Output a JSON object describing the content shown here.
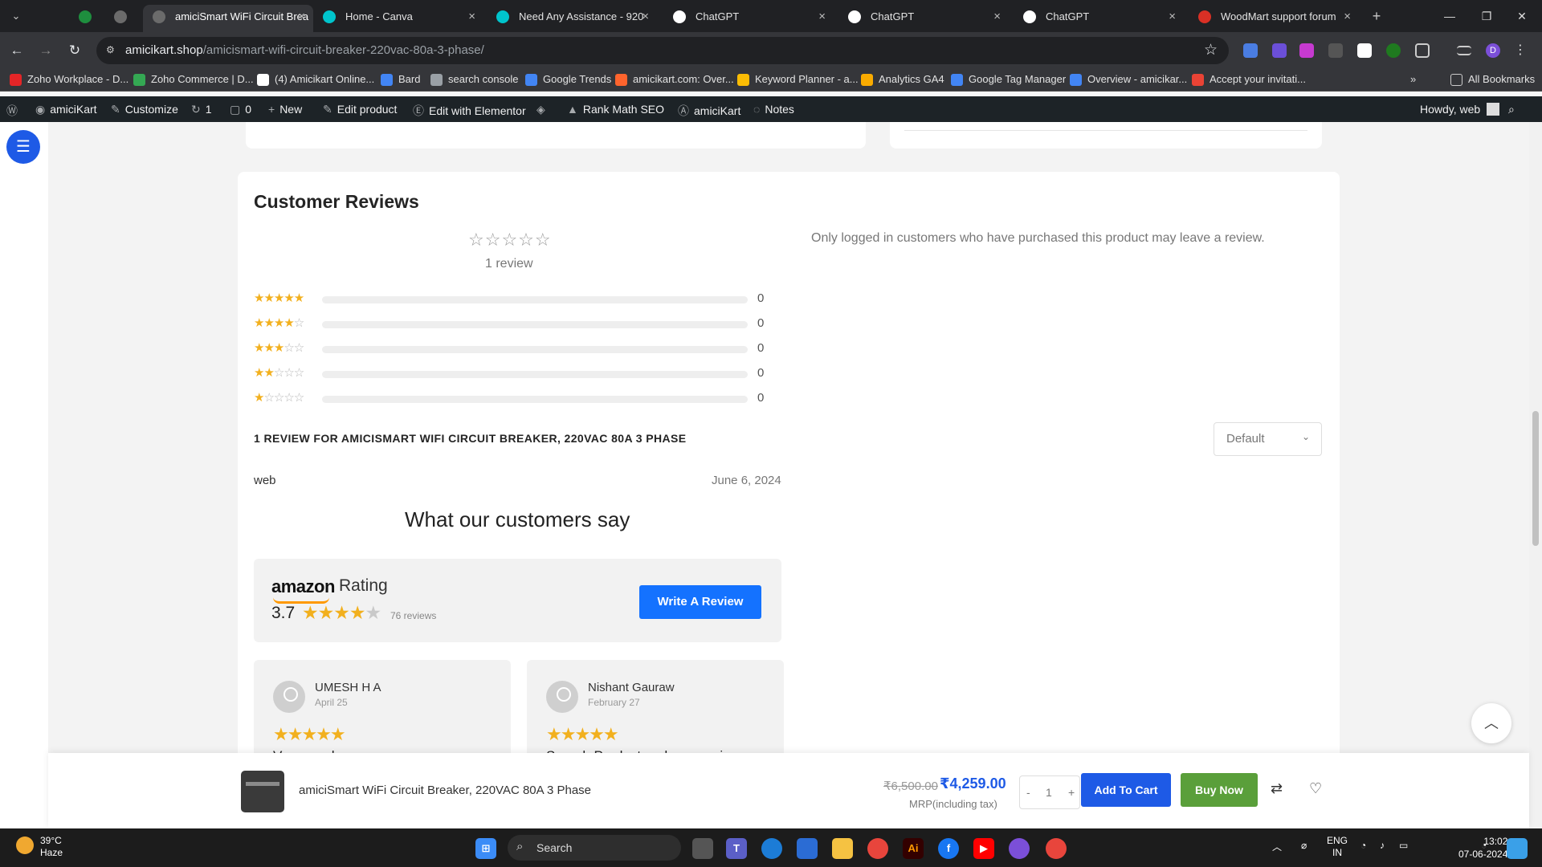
{
  "browser": {
    "tabs": [
      {
        "label": "",
        "icon": "sheets-icon",
        "color": "#1e8e3e"
      },
      {
        "label": "",
        "icon": "globe-icon",
        "color": "#6b6b6b"
      },
      {
        "label": "amiciSmart WiFi Circuit Brea",
        "icon": "globe-icon",
        "color": "#6b6b6b",
        "active": true
      },
      {
        "label": "Home - Canva",
        "icon": "canva-icon",
        "color": "#00c4cc"
      },
      {
        "label": "Need Any Assistance - 920",
        "icon": "canva-icon",
        "color": "#00c4cc"
      },
      {
        "label": "ChatGPT",
        "icon": "chatgpt-icon",
        "color": "#ffffff"
      },
      {
        "label": "ChatGPT",
        "icon": "chatgpt-icon",
        "color": "#ffffff"
      },
      {
        "label": "ChatGPT",
        "icon": "chatgpt-icon",
        "color": "#ffffff"
      },
      {
        "label": "WoodMart support forum",
        "icon": "woodmart-icon",
        "color": "#d93025"
      }
    ],
    "url_host": "amicikart.shop",
    "url_path": "/amicismart-wifi-circuit-breaker-220vac-80a-3-phase/",
    "bookmarks": [
      {
        "label": "Zoho Workplace - D...",
        "color": "#e42527"
      },
      {
        "label": "Zoho Commerce | D...",
        "color": "#34a853"
      },
      {
        "label": "(4) Amicikart Online...",
        "color": "#ffffff"
      },
      {
        "label": "Bard",
        "color": "#4285f4"
      },
      {
        "label": "search console",
        "color": "#9aa0a6"
      },
      {
        "label": "Google Trends",
        "color": "#4285f4"
      },
      {
        "label": "amicikart.com: Over...",
        "color": "#ff642d"
      },
      {
        "label": "Keyword Planner - a...",
        "color": "#fbbc04"
      },
      {
        "label": "Analytics GA4",
        "color": "#f9ab00"
      },
      {
        "label": "Google Tag Manager",
        "color": "#4285f4"
      },
      {
        "label": "Overview - amicikar...",
        "color": "#4285f4"
      },
      {
        "label": "Accept your invitati...",
        "color": "#ea4335"
      }
    ],
    "all_bookmarks": "All Bookmarks"
  },
  "wpbar": {
    "site": "amiciKart",
    "customize": "Customize",
    "updates": "1",
    "comments": "0",
    "new": "New",
    "edit_product": "Edit product",
    "elementor": "Edit with Elementor",
    "rankmath": "Rank Math SEO",
    "amicikart": "amiciKart",
    "notes": "Notes",
    "howdy": "Howdy, web"
  },
  "reviews": {
    "title": "Customer Reviews",
    "review_count_label": "1 review",
    "notice": "Only logged in customers who have purchased this product may leave a review.",
    "histogram": [
      {
        "stars": 5,
        "count": "0",
        "fraction": 0
      },
      {
        "stars": 4,
        "count": "0",
        "fraction": 0
      },
      {
        "stars": 3,
        "count": "0",
        "fraction": 0
      },
      {
        "stars": 2,
        "count": "0",
        "fraction": 0
      },
      {
        "stars": 1,
        "count": "0",
        "fraction": 0
      }
    ],
    "list_heading": "1 REVIEW FOR AMICISMART WIFI CIRCUIT BREAKER, 220VAC 80A 3 PHASE",
    "sort_value": "Default",
    "author": "web",
    "date": "June 6, 2024"
  },
  "widget": {
    "heading": "What our customers say",
    "brand": "amazon",
    "rating_label": "Rating",
    "score": "3.7",
    "star_rating": 3.7,
    "reviews": "76 reviews",
    "write_button": "Write A Review",
    "cards": [
      {
        "name": "UMESH H A",
        "date": "April 25",
        "text": "Very good",
        "stars": 5
      },
      {
        "name": "Nishant Gauraw",
        "date": "February 27",
        "text": "Superb Product and responsive",
        "stars": 5
      }
    ]
  },
  "sticky": {
    "product_name": "amiciSmart WiFi Circuit Breaker, 220VAC 80A 3 Phase",
    "old_price": "₹6,500.00",
    "new_price": "₹4,259.00",
    "tax_note": "MRP(including tax)",
    "qty": "1",
    "minus": "-",
    "plus": "+",
    "add_to_cart": "Add To Cart",
    "buy_now": "Buy Now"
  },
  "taskbar": {
    "temp": "39°C",
    "condition": "Haze",
    "search": "Search",
    "lang1": "ENG",
    "lang2": "IN",
    "time": "13:02",
    "date": "07-06-2024"
  },
  "colors": {
    "accent": "#1e5ae6",
    "star": "#f2b01e",
    "buy": "#5a9f3a",
    "amazon_button": "#1472ff"
  }
}
